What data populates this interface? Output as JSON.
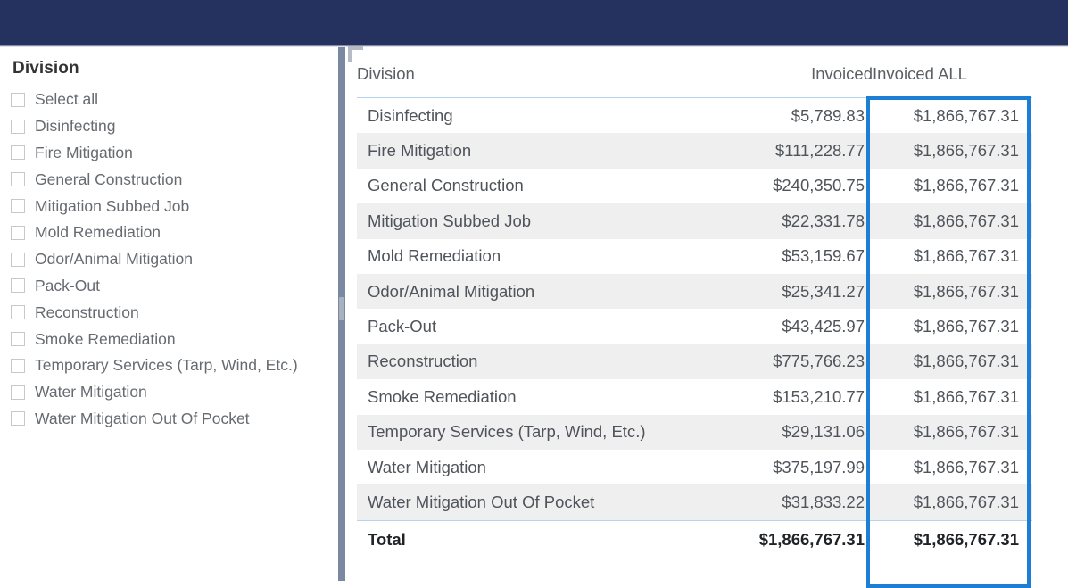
{
  "window": {
    "top_bar_color": "#25315f"
  },
  "slicer": {
    "title": "Division",
    "items": [
      {
        "label": "Select all",
        "checked": false
      },
      {
        "label": "Disinfecting",
        "checked": false
      },
      {
        "label": "Fire Mitigation",
        "checked": false
      },
      {
        "label": "General Construction",
        "checked": false
      },
      {
        "label": "Mitigation Subbed Job",
        "checked": false
      },
      {
        "label": "Mold Remediation",
        "checked": false
      },
      {
        "label": "Odor/Animal Mitigation",
        "checked": false
      },
      {
        "label": "Pack-Out",
        "checked": false
      },
      {
        "label": "Reconstruction",
        "checked": false
      },
      {
        "label": "Smoke Remediation",
        "checked": false
      },
      {
        "label": "Temporary Services (Tarp, Wind, Etc.)",
        "checked": false
      },
      {
        "label": "Water Mitigation",
        "checked": false
      },
      {
        "label": "Water Mitigation Out Of Pocket",
        "checked": false
      }
    ]
  },
  "table": {
    "headers": [
      "Division",
      "Invoiced",
      "Invoiced ALL"
    ],
    "rows": [
      {
        "division": "Disinfecting",
        "invoiced": "$5,789.83",
        "invoiced_all": "$1,866,767.31"
      },
      {
        "division": "Fire Mitigation",
        "invoiced": "$111,228.77",
        "invoiced_all": "$1,866,767.31"
      },
      {
        "division": "General Construction",
        "invoiced": "$240,350.75",
        "invoiced_all": "$1,866,767.31"
      },
      {
        "division": "Mitigation Subbed Job",
        "invoiced": "$22,331.78",
        "invoiced_all": "$1,866,767.31"
      },
      {
        "division": "Mold Remediation",
        "invoiced": "$53,159.67",
        "invoiced_all": "$1,866,767.31"
      },
      {
        "division": "Odor/Animal Mitigation",
        "invoiced": "$25,341.27",
        "invoiced_all": "$1,866,767.31"
      },
      {
        "division": "Pack-Out",
        "invoiced": "$43,425.97",
        "invoiced_all": "$1,866,767.31"
      },
      {
        "division": "Reconstruction",
        "invoiced": "$775,766.23",
        "invoiced_all": "$1,866,767.31"
      },
      {
        "division": "Smoke Remediation",
        "invoiced": "$153,210.77",
        "invoiced_all": "$1,866,767.31"
      },
      {
        "division": "Temporary Services (Tarp, Wind, Etc.)",
        "invoiced": "$29,131.06",
        "invoiced_all": "$1,866,767.31"
      },
      {
        "division": "Water Mitigation",
        "invoiced": "$375,197.99",
        "invoiced_all": "$1,866,767.31"
      },
      {
        "division": "Water Mitigation Out Of Pocket",
        "invoiced": "$31,833.22",
        "invoiced_all": "$1,866,767.31"
      }
    ],
    "total": {
      "division": "Total",
      "invoiced": "$1,866,767.31",
      "invoiced_all": "$1,866,767.31"
    },
    "highlight_color": "#1d7fd4",
    "highlighted_column": "Invoiced ALL"
  }
}
